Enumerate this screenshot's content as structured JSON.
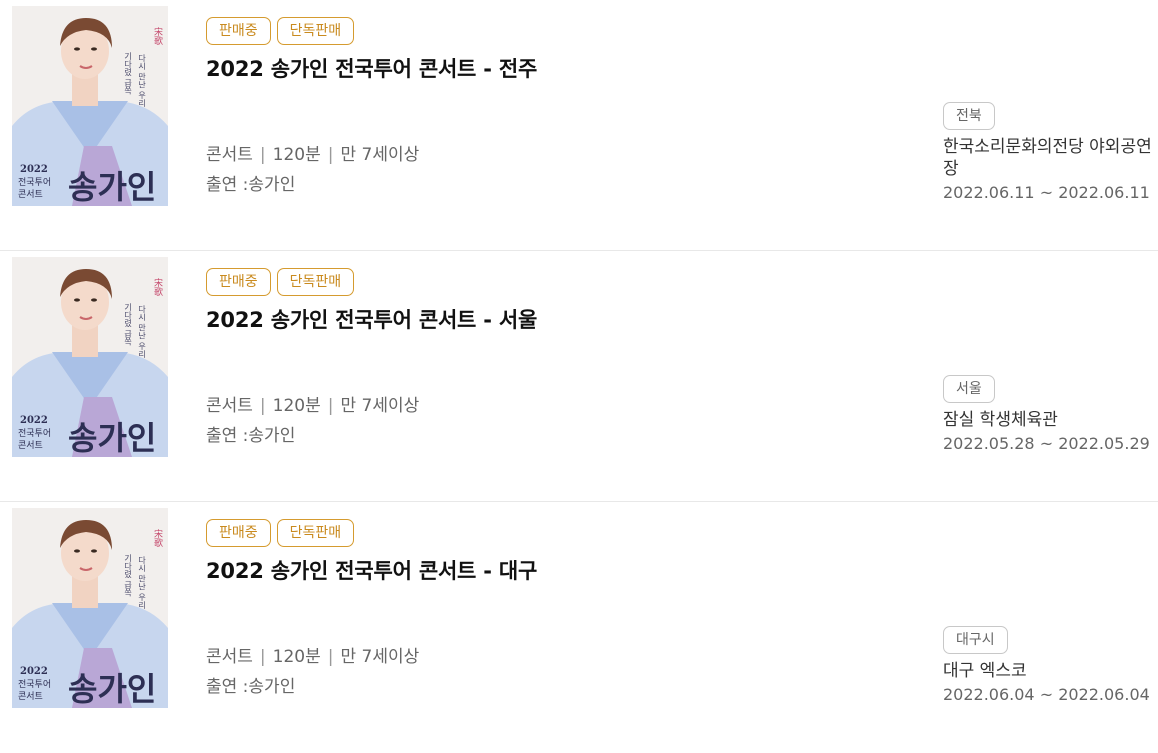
{
  "items": [
    {
      "badges": [
        "판매중",
        "단독판매"
      ],
      "title": "2022 송가인 전국투어 콘서트 - 전주",
      "genre": "콘서트",
      "duration": "120분",
      "age": "만 7세이상",
      "cast": "출연 :송가인",
      "region": "전북",
      "venue": "한국소리문화의전당 야외공연장",
      "dates": "2022.06.11 ~ 2022.06.11",
      "poster": {
        "year": "2022",
        "line1": "전국투어",
        "line2": "콘서트",
        "name": "송가인",
        "tagline1": "기다렸 급쏙",
        "tagline2": "다시 만난 우리"
      }
    },
    {
      "badges": [
        "판매중",
        "단독판매"
      ],
      "title": "2022 송가인 전국투어 콘서트 - 서울",
      "genre": "콘서트",
      "duration": "120분",
      "age": "만 7세이상",
      "cast": "출연 :송가인",
      "region": "서울",
      "venue": "잠실 학생체육관",
      "dates": "2022.05.28 ~ 2022.05.29",
      "poster": {
        "year": "2022",
        "line1": "전국투어",
        "line2": "콘서트",
        "name": "송가인",
        "tagline1": "기다렸 급쏙",
        "tagline2": "다시 만난 우리"
      }
    },
    {
      "badges": [
        "판매중",
        "단독판매"
      ],
      "title": "2022 송가인 전국투어 콘서트 - 대구",
      "genre": "콘서트",
      "duration": "120분",
      "age": "만 7세이상",
      "cast": "출연 :송가인",
      "region": "대구시",
      "venue": "대구 엑스코",
      "dates": "2022.06.04 ~ 2022.06.04",
      "poster": {
        "year": "2022",
        "line1": "전국투어",
        "line2": "콘서트",
        "name": "송가인",
        "tagline1": "기다렸 급쏙",
        "tagline2": "다시 만난 우리"
      }
    }
  ]
}
